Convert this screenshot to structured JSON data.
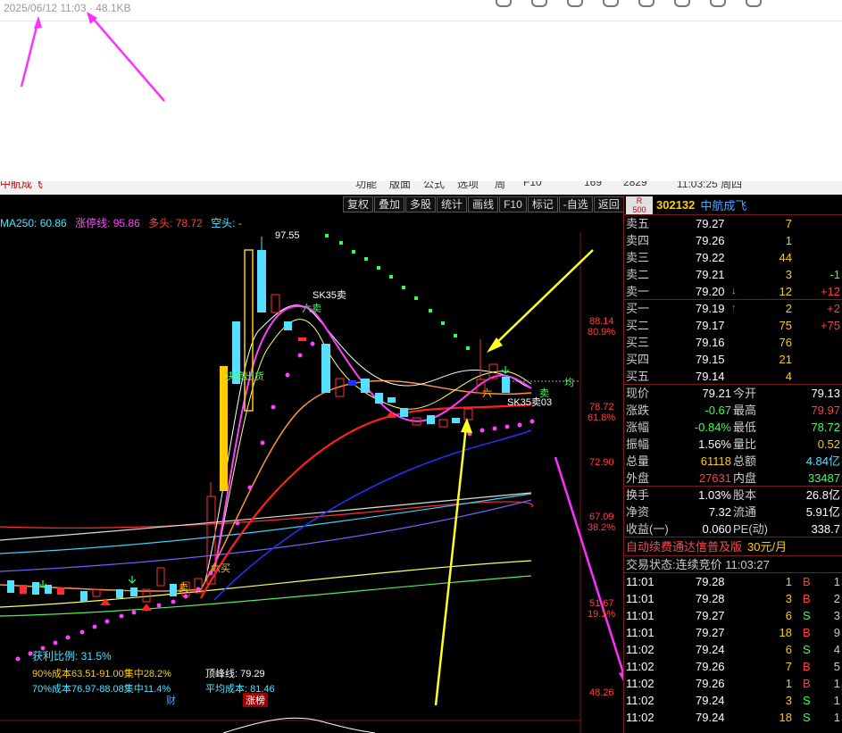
{
  "topbar": {
    "date": "2025/06/12 11:03",
    "size": "48.1KB"
  },
  "app_header": {
    "left_clip": "中航成飞",
    "items": [
      "功能",
      "版面",
      "公式",
      "选项",
      "周",
      "F10",
      "169",
      "2829",
      "11:03:25 周四"
    ]
  },
  "toolbar": [
    "复权",
    "叠加",
    "多股",
    "统计",
    "画线",
    "F10",
    "标记",
    "-自选",
    "返回"
  ],
  "ma_line": {
    "ma250": "MA250: 60.86",
    "limit_up": "涨停线: 95.86",
    "bull": "多头: 78.72",
    "bear": "空头: -"
  },
  "chart_labels": {
    "high": "97.55",
    "sk35_top": "SK35卖",
    "sell6_top": "六卖",
    "buy_zone": "决策出货",
    "sell6_mid": "六",
    "sk35_mid": "SK35卖03",
    "eq_line": "均",
    "sell_mid": "卖",
    "buy_low": "六买",
    "sell_left": "卖",
    "profit_ratio": "获利比例: 31.5%",
    "cost90": "90%成本63.51-91.00集中28.2%",
    "cost70": "70%成本76.97-88.08集中11.4%",
    "peak_line": "顶峰线: 79.29",
    "avg_cost": "平均成本: 81.46",
    "cai": "财",
    "zhangbang": "涨榜"
  },
  "price_axis": [
    {
      "v": "88.14",
      "c": "#ff3030"
    },
    {
      "v": "80.9%",
      "c": "#ff3030"
    },
    {
      "v": "78.72",
      "c": "#ff3030"
    },
    {
      "v": "61.8%",
      "c": "#ff3030"
    },
    {
      "v": "72.90",
      "c": "#ff3030"
    },
    {
      "v": "67.09",
      "c": "#ff3030"
    },
    {
      "v": "38.2%",
      "c": "#ff3030"
    },
    {
      "v": "51.67",
      "c": "#ff3030"
    },
    {
      "v": "19.1%",
      "c": "#ff3030"
    },
    {
      "v": "48.26",
      "c": "#ff3030"
    }
  ],
  "stock": {
    "badge_top": "R",
    "badge_bottom": "500",
    "code": "302132",
    "name": "中航成飞"
  },
  "orderbook": [
    {
      "label": "卖五",
      "price": "79.27",
      "arrow": "",
      "vol": "7",
      "chg": ""
    },
    {
      "label": "卖四",
      "price": "79.26",
      "arrow": "",
      "vol": "1",
      "chg": ""
    },
    {
      "label": "卖三",
      "price": "79.22",
      "arrow": "",
      "vol": "44",
      "chg": ""
    },
    {
      "label": "卖二",
      "price": "79.21",
      "arrow": "",
      "vol": "3",
      "chg": "-1"
    },
    {
      "label": "卖一",
      "price": "79.20",
      "arrow": "↓",
      "vol": "12",
      "chg": "+12"
    },
    {
      "label": "买一",
      "price": "79.19",
      "arrow": "↑",
      "vol": "2",
      "chg": "+2"
    },
    {
      "label": "买二",
      "price": "79.17",
      "arrow": "",
      "vol": "75",
      "chg": "+75"
    },
    {
      "label": "买三",
      "price": "79.16",
      "arrow": "",
      "vol": "76",
      "chg": ""
    },
    {
      "label": "买四",
      "price": "79.15",
      "arrow": "",
      "vol": "21",
      "chg": ""
    },
    {
      "label": "买五",
      "price": "79.14",
      "arrow": "",
      "vol": "4",
      "chg": ""
    }
  ],
  "stats": [
    {
      "l1": "现价",
      "v1": "79.21",
      "c1": "#ffffff",
      "l2": "今开",
      "v2": "79.13",
      "c2": "#ffffff"
    },
    {
      "l1": "涨跌",
      "v1": "-0.67",
      "c1": "#3cff5a",
      "l2": "最高",
      "v2": "79.97",
      "c2": "#ff4040"
    },
    {
      "l1": "涨幅",
      "v1": "-0.84%",
      "c1": "#3cff5a",
      "l2": "最低",
      "v2": "78.72",
      "c2": "#3cff5a"
    },
    {
      "l1": "振幅",
      "v1": "1.56%",
      "c1": "#ffffff",
      "l2": "量比",
      "v2": "0.52",
      "c2": "#ffcc00"
    },
    {
      "l1": "总量",
      "v1": "61118",
      "c1": "#ffcc00",
      "l2": "总额",
      "v2": "4.84亿",
      "c2": "#4fe3ff"
    },
    {
      "l1": "外盘",
      "v1": "27631",
      "c1": "#ff4040",
      "l2": "内盘",
      "v2": "33487",
      "c2": "#3cff5a"
    },
    {
      "l1": "换手",
      "v1": "1.03%",
      "c1": "#ffffff",
      "l2": "股本",
      "v2": "26.8亿",
      "c2": "#ffffff"
    },
    {
      "l1": "净资",
      "v1": "7.32",
      "c1": "#ffffff",
      "l2": "流通",
      "v2": "5.91亿",
      "c2": "#ffffff"
    },
    {
      "l1": "收益(一)",
      "v1": "0.060",
      "c1": "#ffffff",
      "l2": "PE(动)",
      "v2": "338.7",
      "c2": "#ffffff"
    }
  ],
  "promo": {
    "text": "自动续费通达信普及版",
    "price": "30元/月"
  },
  "trade_state": {
    "label": "交易状态:",
    "value": "连续竞价 11:03:27"
  },
  "ticks": [
    {
      "t": "11:01",
      "p": "79.28",
      "v": "1",
      "s": "B",
      "n": "1"
    },
    {
      "t": "11:01",
      "p": "79.28",
      "v": "3",
      "s": "B",
      "n": "2"
    },
    {
      "t": "11:01",
      "p": "79.27",
      "v": "6",
      "s": "S",
      "n": "3"
    },
    {
      "t": "11:01",
      "p": "79.27",
      "v": "18",
      "s": "B",
      "n": "9"
    },
    {
      "t": "11:02",
      "p": "79.24",
      "v": "6",
      "s": "S",
      "n": "4"
    },
    {
      "t": "11:02",
      "p": "79.26",
      "v": "7",
      "s": "B",
      "n": "5"
    },
    {
      "t": "11:02",
      "p": "79.26",
      "v": "1",
      "s": "B",
      "n": "1"
    },
    {
      "t": "11:02",
      "p": "79.24",
      "v": "3",
      "s": "S",
      "n": "1"
    },
    {
      "t": "11:02",
      "p": "79.24",
      "v": "18",
      "s": "S",
      "n": "1"
    }
  ]
}
